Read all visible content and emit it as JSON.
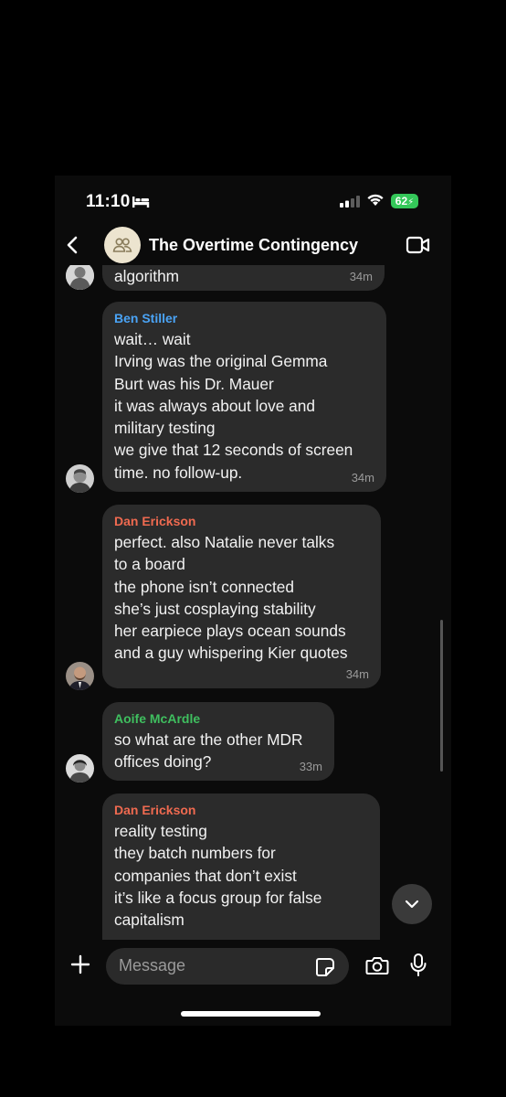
{
  "status_bar": {
    "time": "11:10",
    "battery": "62"
  },
  "header": {
    "title": "The Overtime Contingency"
  },
  "messages": [
    {
      "sender": "",
      "sender_color": "",
      "lines": [
        "algorithm"
      ],
      "time": "34m"
    },
    {
      "sender": "Ben Stiller",
      "sender_color": "#4aa3f5",
      "lines": [
        "wait… wait",
        "Irving was the original Gemma",
        "Burt was his Dr. Mauer",
        "it was always about love and",
        "military testing",
        "we give that 12 seconds of screen",
        "time. no follow-up."
      ],
      "time": "34m"
    },
    {
      "sender": "Dan Erickson",
      "sender_color": "#ef6a50",
      "lines": [
        "perfect. also Natalie never talks",
        "to a board",
        "the phone isn’t connected",
        "she’s just cosplaying stability",
        "her earpiece plays ocean sounds",
        "and a guy whispering Kier quotes"
      ],
      "time": "34m"
    },
    {
      "sender": "Aoife McArdle",
      "sender_color": "#3fbf5f",
      "lines": [
        "so what are the other MDR",
        "offices doing?"
      ],
      "time": "33m"
    },
    {
      "sender": "Dan Erickson",
      "sender_color": "#ef6a50",
      "lines": [
        "reality testing",
        "they batch numbers for",
        "companies that don’t exist",
        "it’s like a focus group for false",
        "capitalism",
        "…"
      ],
      "time": ""
    }
  ],
  "composer": {
    "placeholder": "Message"
  },
  "icons": [
    "bed-icon",
    "signal-icon",
    "wifi-icon",
    "battery-icon",
    "back-icon",
    "group-avatar-icon",
    "video-call-icon",
    "scroll-down-icon",
    "plus-icon",
    "sticker-icon",
    "camera-icon",
    "microphone-icon"
  ]
}
